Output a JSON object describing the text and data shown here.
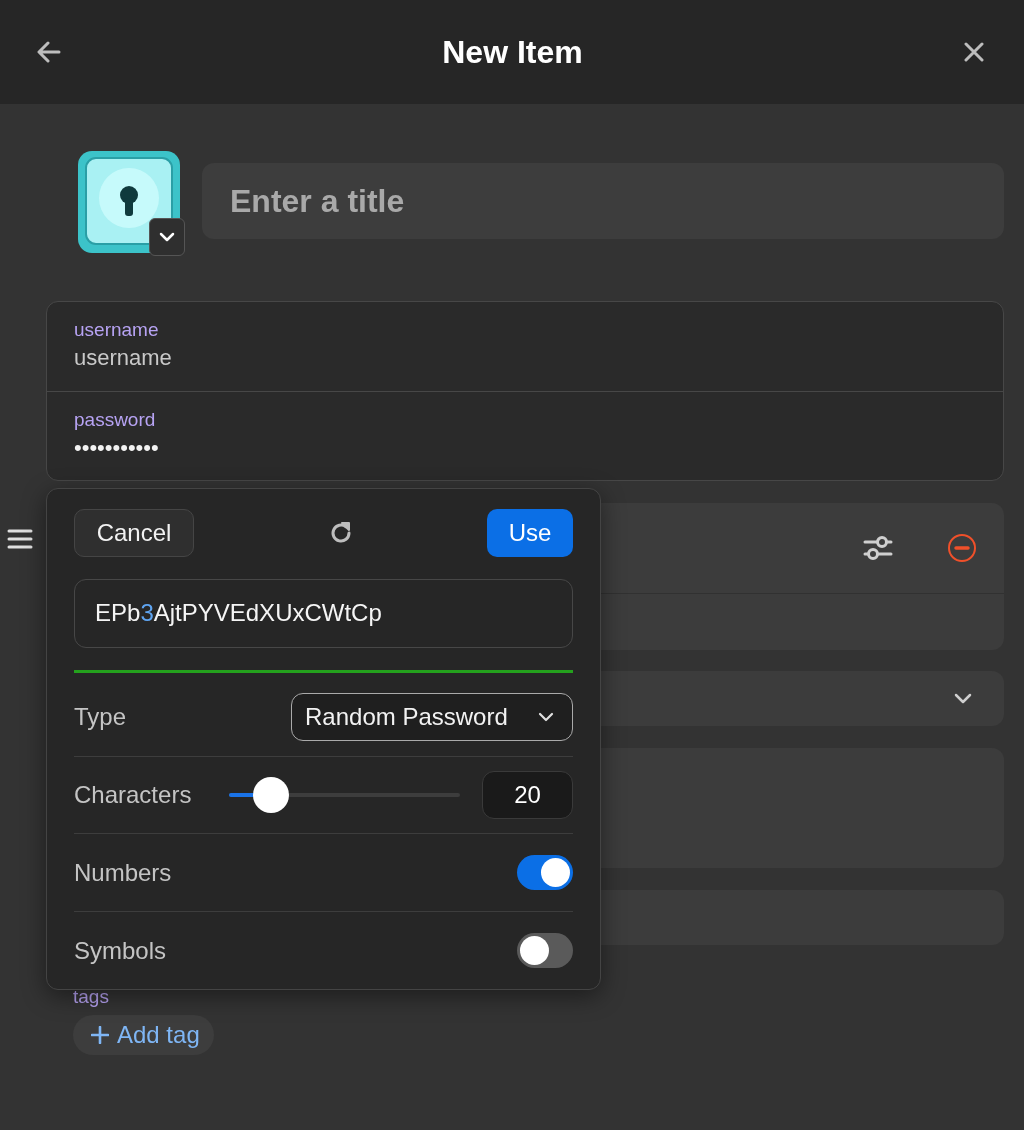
{
  "header": {
    "title": "New Item"
  },
  "title_field": {
    "placeholder": "Enter a title"
  },
  "credentials": [
    {
      "label": "username",
      "placeholder": "username"
    },
    {
      "label": "password",
      "value": "•••••••••••"
    }
  ],
  "tags": {
    "label": "tags",
    "add_button": "Add tag"
  },
  "generator": {
    "cancel": "Cancel",
    "use": "Use",
    "password": [
      {
        "kind": "letters",
        "text": "EPb"
      },
      {
        "kind": "digit",
        "text": "3"
      },
      {
        "kind": "letters",
        "text": "AjtPYVEdXUxCWtCp"
      }
    ],
    "strength": {
      "level": 1
    },
    "options": [
      {
        "kind": "select",
        "label": "Type",
        "value": "Random Password"
      },
      {
        "kind": "slider",
        "label": "Characters",
        "level": 0.18,
        "value": "20"
      },
      {
        "kind": "toggle",
        "label": "Numbers",
        "on": true
      },
      {
        "kind": "toggle",
        "label": "Symbols",
        "on": false
      }
    ]
  }
}
